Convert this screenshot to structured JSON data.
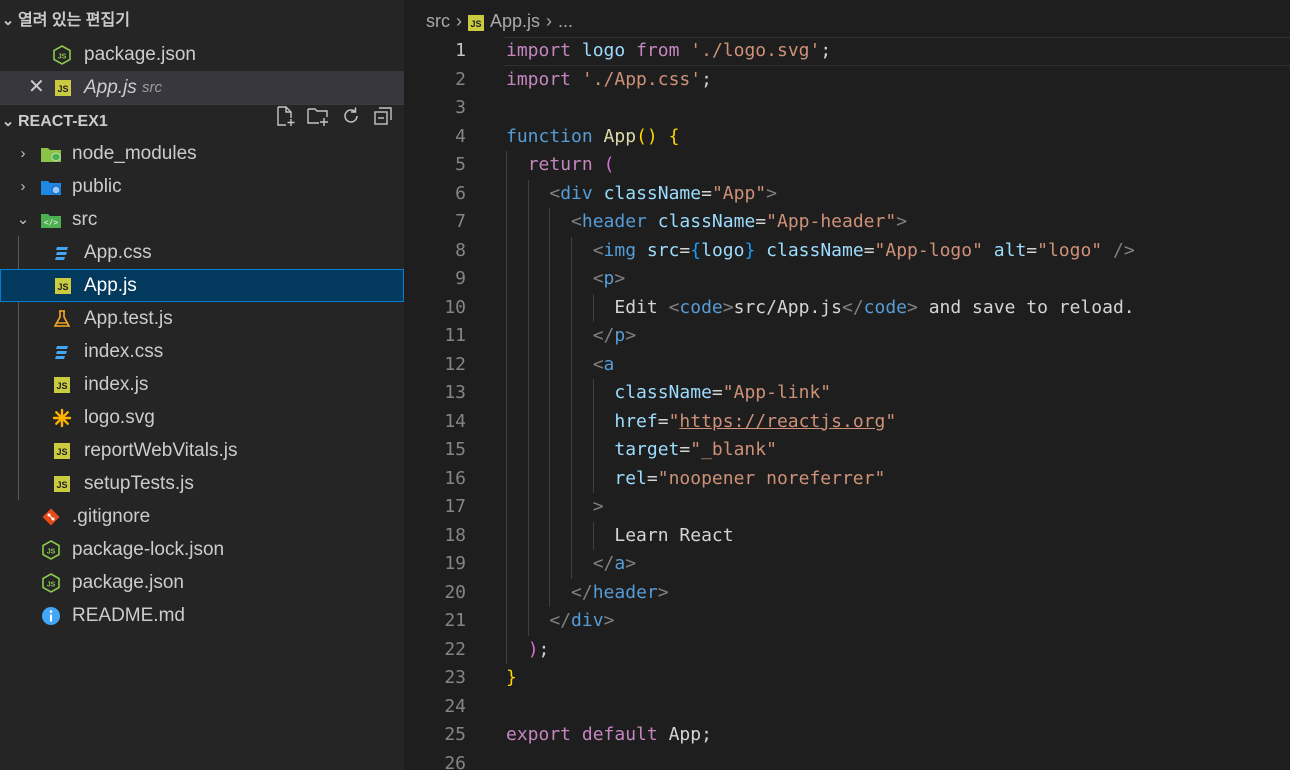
{
  "open_editors": {
    "title": "열려 있는 편집기",
    "items": [
      {
        "name": "package.json",
        "dir": ""
      },
      {
        "name": "App.js",
        "dir": "src"
      }
    ]
  },
  "explorer": {
    "root": "REACT-EX1",
    "items": [
      {
        "label": "node_modules"
      },
      {
        "label": "public"
      },
      {
        "label": "src"
      },
      {
        "label": "App.css"
      },
      {
        "label": "App.js"
      },
      {
        "label": "App.test.js"
      },
      {
        "label": "index.css"
      },
      {
        "label": "index.js"
      },
      {
        "label": "logo.svg"
      },
      {
        "label": "reportWebVitals.js"
      },
      {
        "label": "setupTests.js"
      },
      {
        "label": ".gitignore"
      },
      {
        "label": "package-lock.json"
      },
      {
        "label": "package.json"
      },
      {
        "label": "README.md"
      }
    ]
  },
  "breadcrumb": {
    "folder": "src",
    "file": "App.js",
    "more": "..."
  },
  "editor": {
    "active_line": 1,
    "line_numbers": [
      "1",
      "2",
      "3",
      "4",
      "5",
      "6",
      "7",
      "8",
      "9",
      "10",
      "11",
      "12",
      "13",
      "14",
      "15",
      "16",
      "17",
      "18",
      "19",
      "20",
      "21",
      "22",
      "23",
      "24",
      "25",
      "26"
    ],
    "lines": [
      "import logo from './logo.svg';",
      "import './App.css';",
      "",
      "function App() {",
      "  return (",
      "    <div className=\"App\">",
      "      <header className=\"App-header\">",
      "        <img src={logo} className=\"App-logo\" alt=\"logo\" />",
      "        <p>",
      "          Edit <code>src/App.js</code> and save to reload.",
      "        </p>",
      "        <a",
      "          className=\"App-link\"",
      "          href=\"https://reactjs.org\"",
      "          target=\"_blank\"",
      "          rel=\"noopener noreferrer\"",
      "        >",
      "          Learn React",
      "        </a>",
      "      </header>",
      "    </div>",
      "  );",
      "}",
      "",
      "export default App;",
      ""
    ]
  },
  "colors": {
    "sidebar_bg": "#252526",
    "editor_bg": "#1e1e1e",
    "selection_bg": "#04395e",
    "selection_border": "#007fd4",
    "js_badge": "#cbcb41",
    "css_icon": "#42a5f5"
  },
  "icons": [
    "chevron-down-icon",
    "chevron-right-icon",
    "close-icon",
    "js-file-icon",
    "nodejs-icon",
    "css-file-icon",
    "test-file-icon",
    "svg-file-icon",
    "git-icon",
    "info-icon",
    "folder-node-icon",
    "folder-public-icon",
    "folder-src-icon",
    "new-file-icon",
    "new-folder-icon",
    "refresh-icon",
    "collapse-all-icon"
  ]
}
